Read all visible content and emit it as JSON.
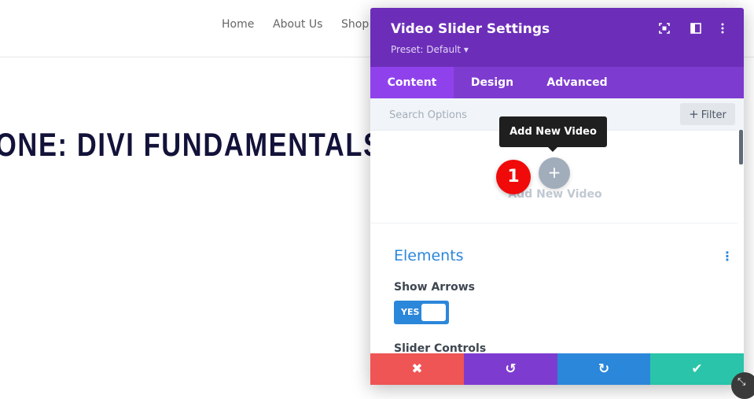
{
  "site": {
    "nav": [
      "Home",
      "About Us",
      "Shop"
    ],
    "hero_title": "ONE: DIVI FUNDAMENTALS"
  },
  "modal": {
    "title": "Video Slider Settings",
    "preset": "Preset: Default ▾",
    "header_icons": [
      "expand-icon",
      "split-view-icon",
      "kebab-menu-icon"
    ],
    "tabs": [
      {
        "label": "Content",
        "active": true
      },
      {
        "label": "Design",
        "active": false
      },
      {
        "label": "Advanced",
        "active": false
      }
    ],
    "search": {
      "placeholder": "Search Options",
      "value": ""
    },
    "filter_label": "Filter",
    "add": {
      "tooltip": "Add New Video",
      "button_symbol": "+",
      "label": "Add New Video",
      "badge": "1"
    },
    "elements": {
      "title": "Elements",
      "show_arrows_label": "Show Arrows",
      "toggle_value": "YES",
      "slider_controls_label": "Slider Controls"
    },
    "footer": [
      {
        "name": "discard",
        "symbol": "✖",
        "color": "#ef5555"
      },
      {
        "name": "undo",
        "symbol": "↺",
        "color": "#7e3bd0"
      },
      {
        "name": "redo",
        "symbol": "↻",
        "color": "#2b87da"
      },
      {
        "name": "save",
        "symbol": "✔",
        "color": "#29c4a9"
      }
    ]
  },
  "colors": {
    "header": "#6c2eb9",
    "tabs": "#7e3bd0",
    "active_tab": "#8f42ec",
    "accent_blue": "#2b87da",
    "badge_red": "#f00a0a"
  }
}
